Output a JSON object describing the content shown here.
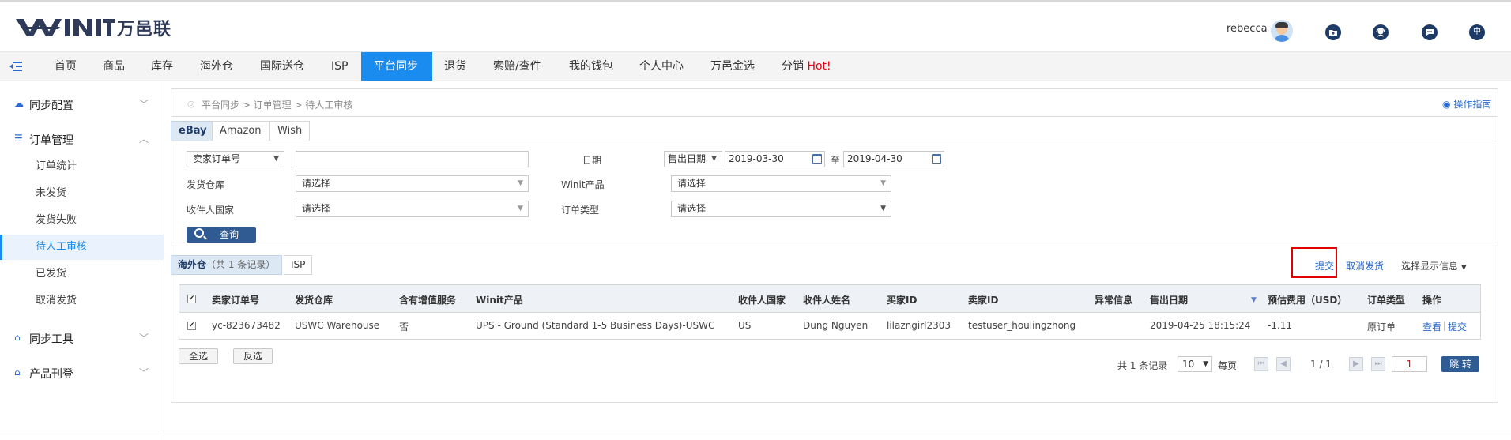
{
  "header": {
    "logo_text": "万邑联",
    "username": "rebecca",
    "lang_icon_text": "中"
  },
  "nav": {
    "items": [
      "首页",
      "商品",
      "库存",
      "海外仓",
      "国际送仓",
      "ISP",
      "平台同步",
      "退货",
      "索赔/查件",
      "我的钱包",
      "个人中心",
      "万邑金选",
      "分销"
    ],
    "hot_label": "Hot!",
    "active_index": 6
  },
  "sidebar": {
    "groups": [
      {
        "label": "同步配置",
        "expanded": false
      },
      {
        "label": "订单管理",
        "expanded": true
      },
      {
        "label": "同步工具",
        "expanded": false
      },
      {
        "label": "产品刊登",
        "expanded": false
      }
    ],
    "order_items": [
      "订单统计",
      "未发货",
      "发货失败",
      "待人工审核",
      "已发货",
      "取消发货"
    ],
    "active_item": "待人工审核"
  },
  "breadcrumb": {
    "path": "平台同步 > 订单管理 > 待人工审核",
    "guide_label": "操作指南"
  },
  "platform_tabs": [
    "eBay",
    "Amazon",
    "Wish"
  ],
  "filters": {
    "order_no_type": "卖家订单号",
    "order_no_value": "",
    "date_label": "日期",
    "date_type": "售出日期",
    "date_from": "2019-03-30",
    "date_to_label": "至",
    "date_to": "2019-04-30",
    "warehouse_label": "发货仓库",
    "warehouse_value": "请选择",
    "product_label": "Winit产品",
    "product_value": "请选择",
    "country_label": "收件人国家",
    "country_value": "请选择",
    "order_type_label": "订单类型",
    "order_type_value": "请选择",
    "search_label": "查询"
  },
  "result_tabs": {
    "overseas": "海外仓",
    "overseas_count": "（共 1 条记录）",
    "isp": "ISP"
  },
  "actions": {
    "submit": "提交",
    "cancel_ship": "取消发货",
    "select_display": "选择显示信息"
  },
  "table": {
    "headers": [
      "卖家订单号",
      "发货仓库",
      "含有增值服务",
      "Winit产品",
      "收件人国家",
      "收件人姓名",
      "买家ID",
      "卖家ID",
      "异常信息",
      "售出日期",
      "预估费用（USD）",
      "订单类型",
      "操作"
    ],
    "rows": [
      {
        "checked": true,
        "order_no": "yc-823673482",
        "warehouse": "USWC Warehouse",
        "value_added": "否",
        "product": "UPS - Ground (Standard 1-5 Business Days)-USWC",
        "country": "US",
        "recipient": "Dung Nguyen",
        "buyer_id": "lilazngirl2303",
        "seller_id": "testuser_houlingzhong",
        "exception": "",
        "sold_date": "2019-04-25 18:15:24",
        "fee": "-1.11",
        "order_type": "原订单",
        "op_view": "查看",
        "op_submit": "提交"
      }
    ]
  },
  "bulk": {
    "select_all": "全选",
    "invert": "反选"
  },
  "pager": {
    "total_text": "共 1 条记录",
    "page_size": "10",
    "per_page_label": "每页",
    "page_info": "1 / 1",
    "page_input": "1",
    "jump_label": "跳 转"
  },
  "colors": {
    "brand_navy": "#2e3a57",
    "nav_active": "#1a8cf0",
    "primary_button": "#2f5a92",
    "highlight_box": "#e00000",
    "hot": "#e60012"
  }
}
